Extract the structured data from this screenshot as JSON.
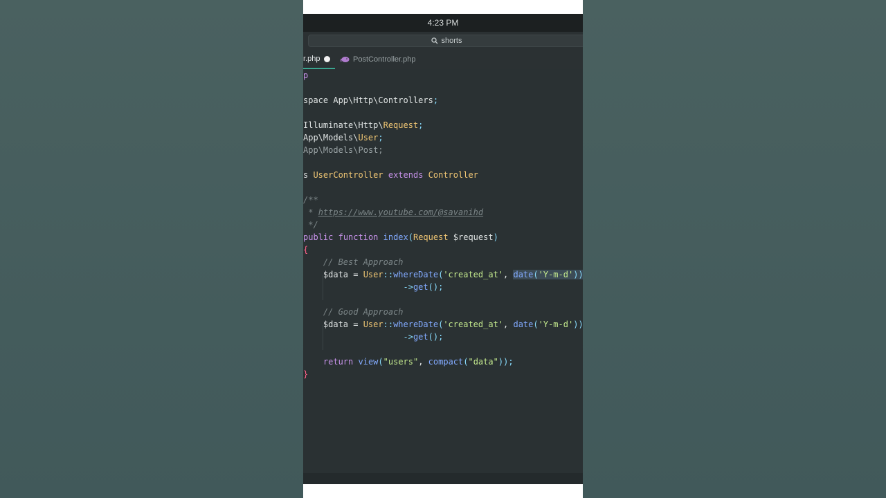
{
  "status_bar": {
    "time": "4:23 PM"
  },
  "search": {
    "value": "shorts"
  },
  "tabs": [
    {
      "label": "r.php",
      "active": true,
      "modified": true
    },
    {
      "label": "PostController.php",
      "active": false
    }
  ],
  "code": {
    "lines": [
      "p",
      "",
      "space App\\Http\\Controllers;",
      "",
      "Illuminate\\Http\\Request;",
      "App\\Models\\User;",
      "App\\Models\\Post;",
      "",
      "s UserController extends Controller",
      "",
      "/**",
      " * https://www.youtube.com/@savanihd",
      " */",
      "public function index(Request $request)",
      "{",
      "    // Best Approach",
      "    $data = User::whereDate('created_at', date('Y-m-d'))",
      "                    ->get();",
      "",
      "    // Good Approach",
      "    $data = User::whereDate('created_at', date('Y-m-d'))",
      "                    ->get();",
      "",
      "    return view(\"users\", compact(\"data\"));",
      "}"
    ]
  },
  "colors": {
    "editor_bg": "#2a3133",
    "keyword": "#c792ea",
    "class": "#f0c674",
    "function": "#82aaff",
    "string": "#c3e88d",
    "comment": "#7b8587",
    "accent": "#3aa58f"
  }
}
